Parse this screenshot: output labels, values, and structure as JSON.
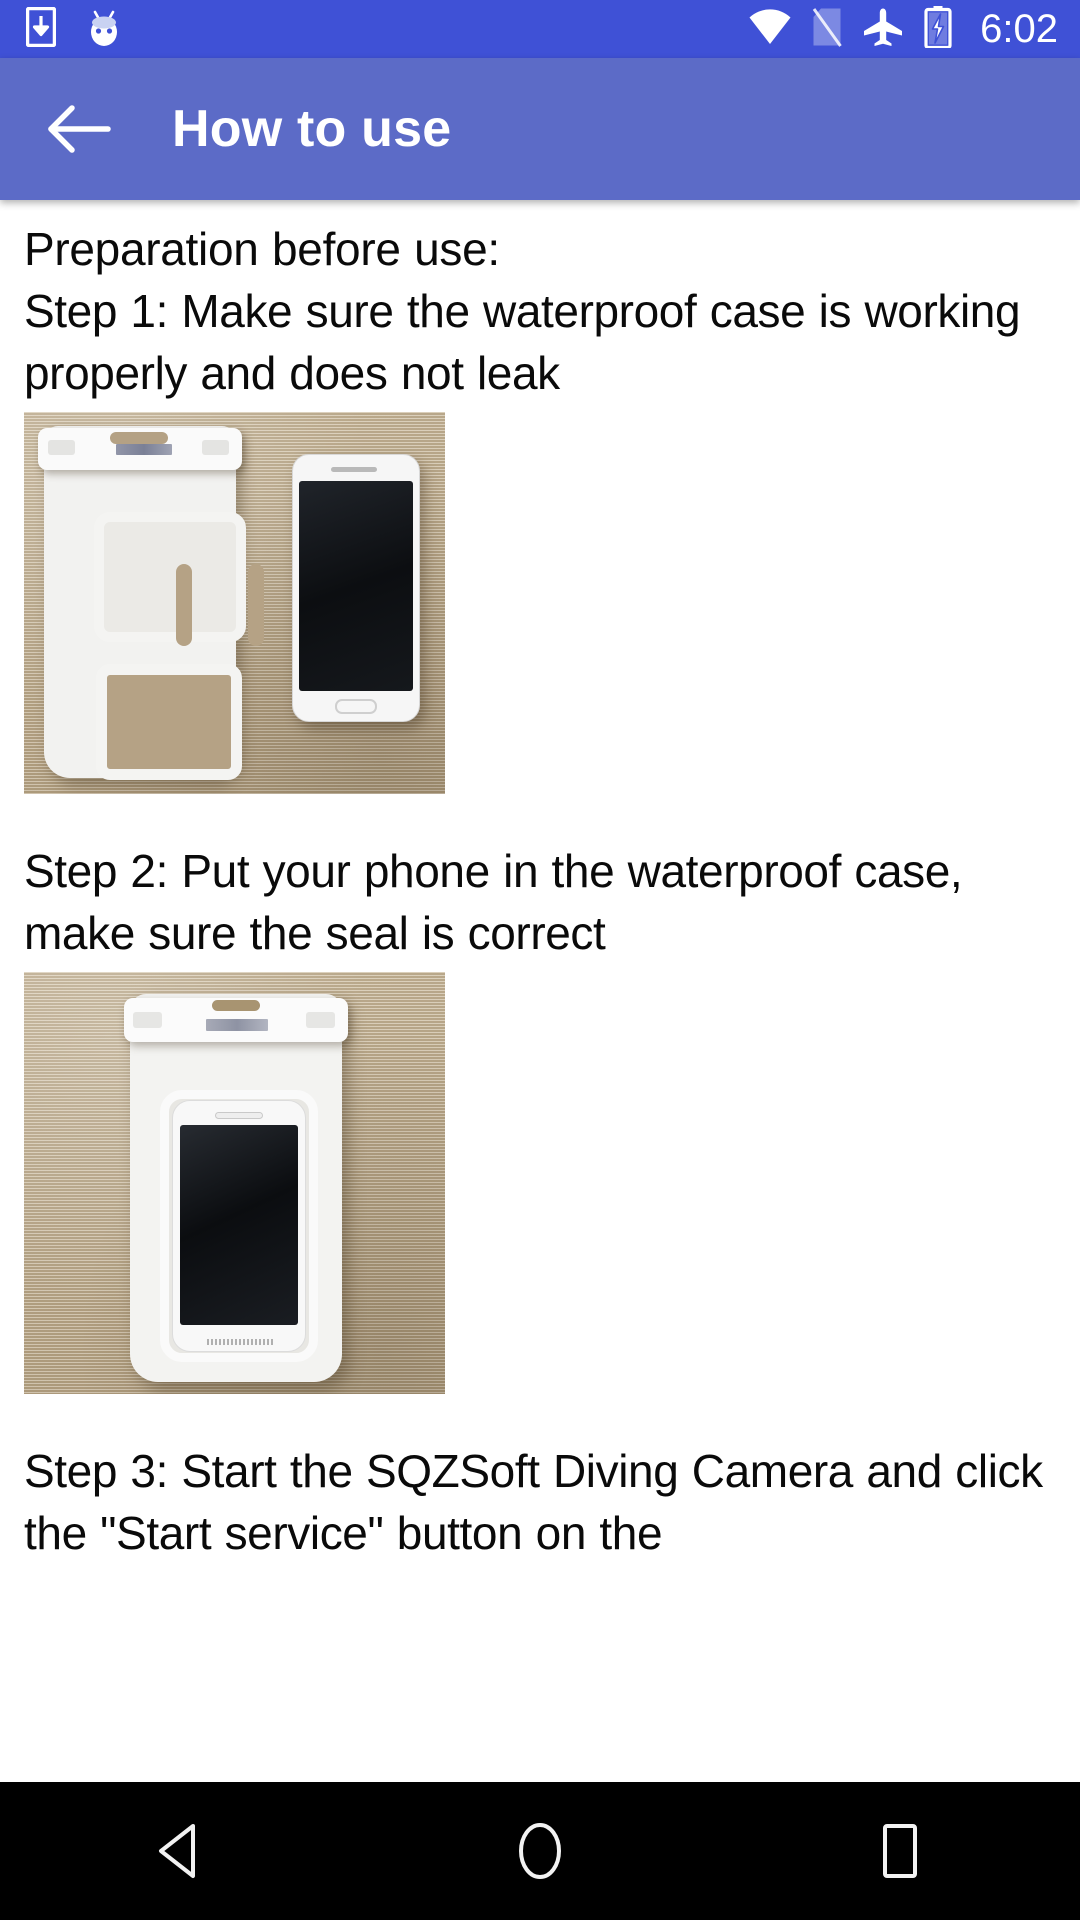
{
  "status_bar": {
    "background_color": "#3f51d6",
    "clock": "6:02",
    "left_icons": [
      {
        "name": "download-notification-icon",
        "glyph": "download-box"
      },
      {
        "name": "android-easter-egg-icon",
        "glyph": "marshmallow-face"
      }
    ],
    "right_icons": [
      {
        "name": "wifi-icon",
        "glyph": "wifi-full"
      },
      {
        "name": "no-sim-card-icon",
        "glyph": "sim-crossed"
      },
      {
        "name": "airplane-mode-icon",
        "glyph": "airplane"
      },
      {
        "name": "battery-charging-icon",
        "glyph": "battery-bolt"
      }
    ]
  },
  "app_bar": {
    "background_color": "#5c6bc7",
    "back_label": "Back",
    "title": "How to use"
  },
  "content": {
    "intro_heading": "Preparation before use:",
    "steps": [
      {
        "id": "step-1",
        "text": "Step 1: Make sure the waterproof case is working properly and does not leak",
        "image_alt": "White waterproof pouch lying next to a white smartphone on a woven desk mat"
      },
      {
        "id": "step-2",
        "text": "Step 2: Put your phone in the waterproof case, make sure the seal is correct",
        "image_alt": "White smartphone sealed inside the white waterproof pouch on a woven desk mat"
      },
      {
        "id": "step-3",
        "text": "Step 3: Start the SQZSoft Diving Camera and click the \"Start service\" button on the",
        "truncated": true
      }
    ]
  },
  "nav_bar": {
    "background_color": "#000000",
    "buttons": [
      {
        "name": "nav-back-button",
        "label": "Back"
      },
      {
        "name": "nav-home-button",
        "label": "Home"
      },
      {
        "name": "nav-recents-button",
        "label": "Recents"
      }
    ]
  }
}
